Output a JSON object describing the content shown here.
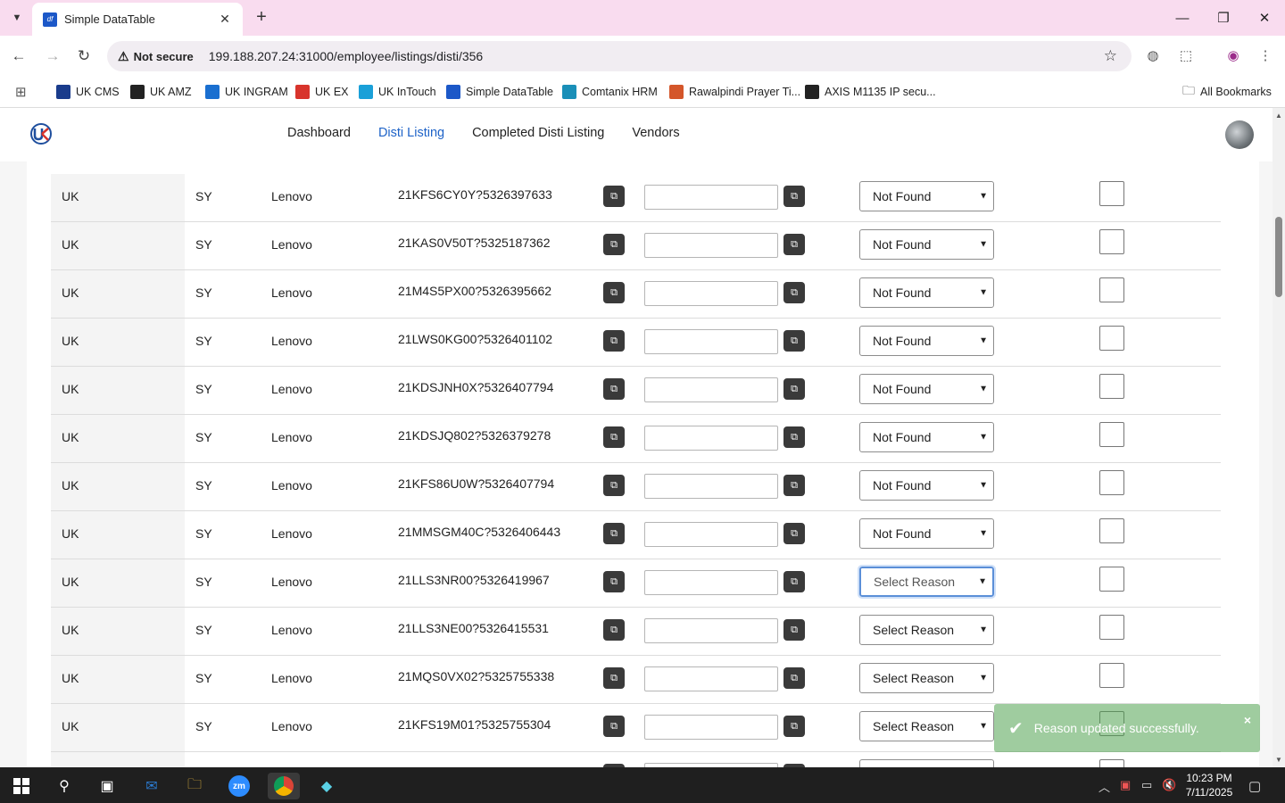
{
  "browser": {
    "tab_title": "Simple DataTable",
    "security_label": "Not secure",
    "url": "199.188.207.24:31000/employee/listings/disti/356",
    "bookmarks": [
      {
        "label": "UK CMS",
        "color": "#1a3c8c"
      },
      {
        "label": "UK AMZ",
        "color": "#222222"
      },
      {
        "label": "UK INGRAM",
        "color": "#1a6fd0"
      },
      {
        "label": "UK EX",
        "color": "#d8342c"
      },
      {
        "label": "UK InTouch",
        "color": "#1aa0d8"
      },
      {
        "label": "Simple DataTable",
        "color": "#1c58c8"
      },
      {
        "label": "Comtanix HRM",
        "color": "#1a8fb8"
      },
      {
        "label": "Rawalpindi Prayer Ti...",
        "color": "#d4562a"
      },
      {
        "label": "AXIS M1135 IP secu...",
        "color": "#222222"
      }
    ],
    "all_bookmarks": "All Bookmarks"
  },
  "app": {
    "nav": [
      "Dashboard",
      "Disti Listing",
      "Completed Disti Listing",
      "Vendors"
    ],
    "active_nav": "Disti Listing"
  },
  "rows": [
    {
      "region": "UK",
      "code": "SY",
      "brand": "Lenovo",
      "sku": "21KFS6CY0Y?5326397633",
      "input": "",
      "reason": "Not Found",
      "checked": false
    },
    {
      "region": "UK",
      "code": "SY",
      "brand": "Lenovo",
      "sku": "21KAS0V50T?5325187362",
      "input": "",
      "reason": "Not Found",
      "checked": false
    },
    {
      "region": "UK",
      "code": "SY",
      "brand": "Lenovo",
      "sku": "21M4S5PX00?5326395662",
      "input": "",
      "reason": "Not Found",
      "checked": false
    },
    {
      "region": "UK",
      "code": "SY",
      "brand": "Lenovo",
      "sku": "21LWS0KG00?5326401102",
      "input": "",
      "reason": "Not Found",
      "checked": false
    },
    {
      "region": "UK",
      "code": "SY",
      "brand": "Lenovo",
      "sku": "21KDSJNH0X?5326407794",
      "input": "",
      "reason": "Not Found",
      "checked": false
    },
    {
      "region": "UK",
      "code": "SY",
      "brand": "Lenovo",
      "sku": "21KDSJQ802?5326379278",
      "input": "",
      "reason": "Not Found",
      "checked": false
    },
    {
      "region": "UK",
      "code": "SY",
      "brand": "Lenovo",
      "sku": "21KFS86U0W?5326407794",
      "input": "",
      "reason": "Not Found",
      "checked": false
    },
    {
      "region": "UK",
      "code": "SY",
      "brand": "Lenovo",
      "sku": "21MMSGM40C?5326406443",
      "input": "",
      "reason": "Not Found",
      "checked": false
    },
    {
      "region": "UK",
      "code": "SY",
      "brand": "Lenovo",
      "sku": "21LLS3NR00?5326419967",
      "input": "",
      "reason": "Select Reason",
      "checked": false,
      "focused": true
    },
    {
      "region": "UK",
      "code": "SY",
      "brand": "Lenovo",
      "sku": "21LLS3NE00?5326415531",
      "input": "",
      "reason": "Select Reason",
      "checked": false
    },
    {
      "region": "UK",
      "code": "SY",
      "brand": "Lenovo",
      "sku": "21MQS0VX02?5325755338",
      "input": "",
      "reason": "Select Reason",
      "checked": false
    },
    {
      "region": "UK",
      "code": "SY",
      "brand": "Lenovo",
      "sku": "21KFS19M01?5325755304",
      "input": "",
      "reason": "Select Reason",
      "checked": false
    }
  ],
  "toast": {
    "message": "Reason updated successfully.",
    "close": "×"
  },
  "taskbar": {
    "time": "10:23 PM",
    "date": "7/11/2025"
  }
}
